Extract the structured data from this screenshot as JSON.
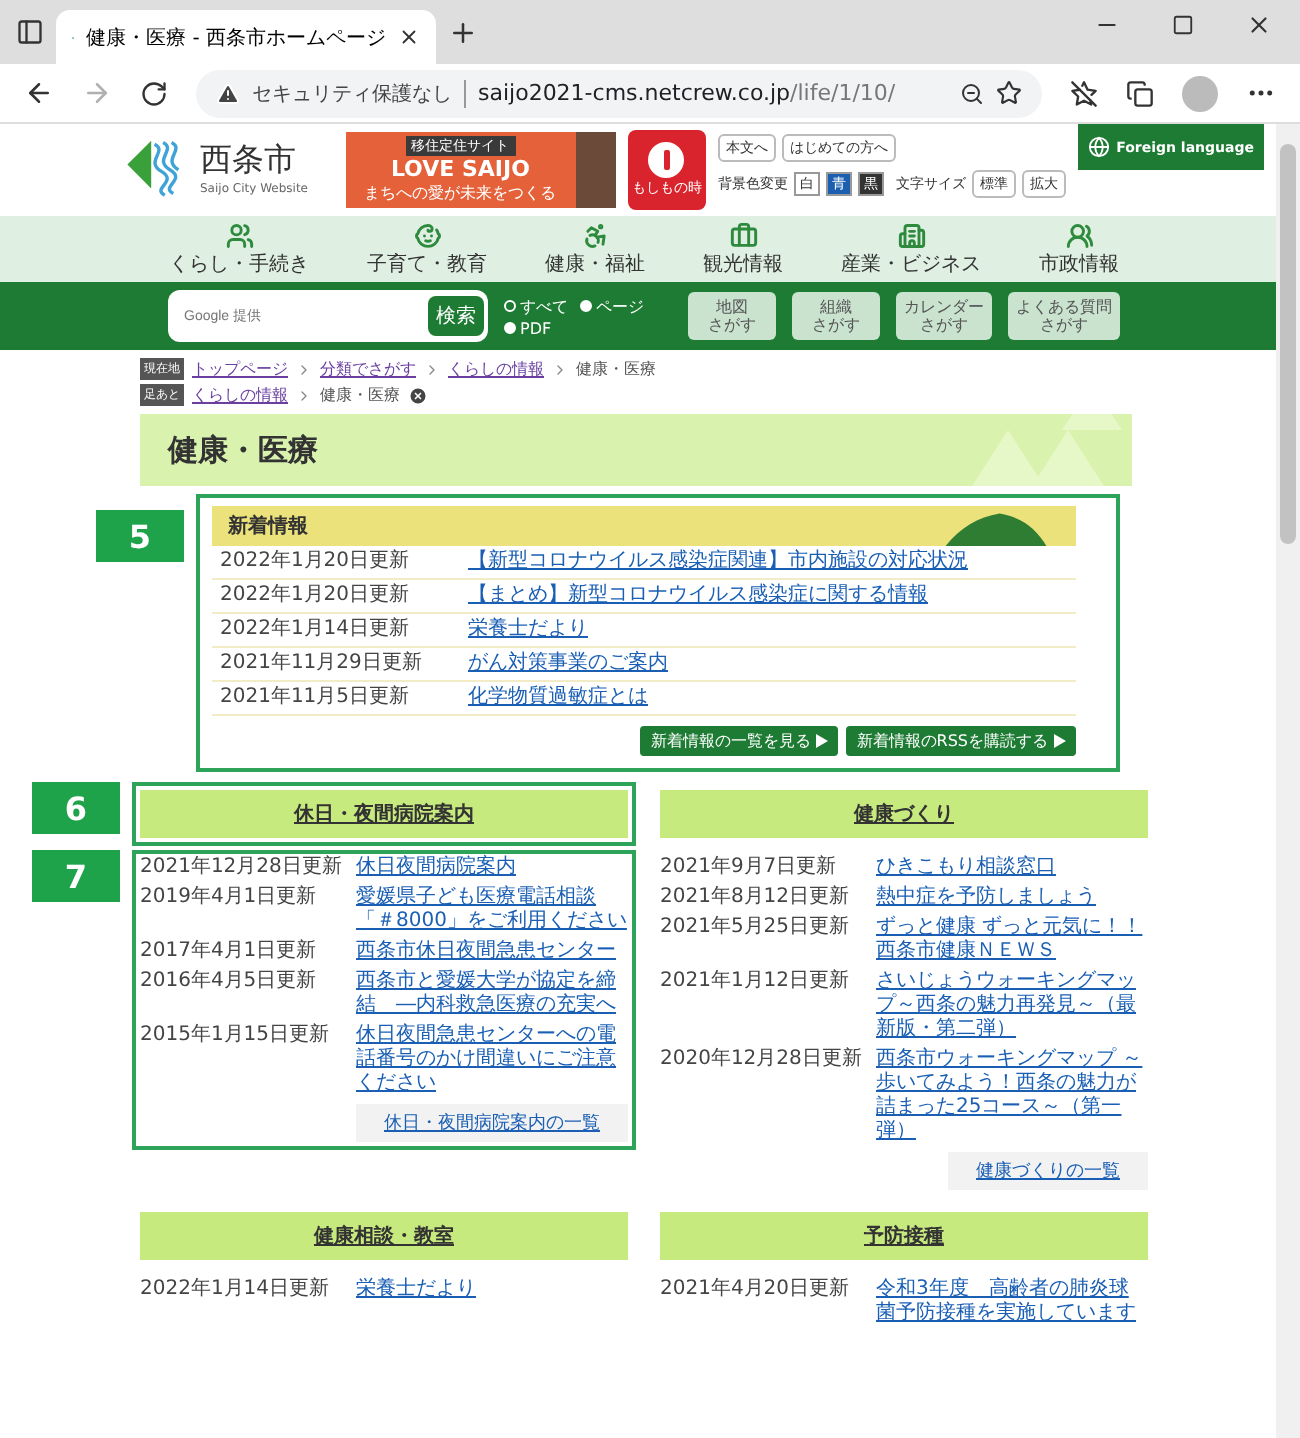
{
  "browser": {
    "tab_title": "健康・医療 - 西条市ホームページ",
    "security": "セキュリティ保護なし",
    "url_host": "saijo2021-cms.netcrew.co.jp",
    "url_path": "/life/1/10/"
  },
  "header": {
    "logo_name": "西条市",
    "logo_sub": "Saijo City Website",
    "banner_top": "移住定住サイト",
    "banner_main": "LOVE SAIJO",
    "banner_sub": "まちへの愛が未来をつくる",
    "emergency": "もしもの時",
    "links": [
      "本文へ",
      "はじめての方へ"
    ],
    "foreign": "Foreign language",
    "bg_label": "背景色変更",
    "bg_options": [
      {
        "label": "白",
        "color": "#ffffff"
      },
      {
        "label": "青",
        "color": "#1c5fb0"
      },
      {
        "label": "黒",
        "color": "#333333"
      }
    ],
    "size_label": "文字サイズ",
    "size_options": [
      "標準",
      "拡大"
    ]
  },
  "nav": [
    "くらし・手続き",
    "子育て・教育",
    "健康・福祉",
    "観光情報",
    "産業・ビジネス",
    "市政情報"
  ],
  "search": {
    "placeholder": "Google 提供",
    "button": "検索",
    "scopes": [
      {
        "label": "すべて",
        "selected": true
      },
      {
        "label": "ページ",
        "selected": false
      },
      {
        "label": "PDF",
        "selected": false
      }
    ],
    "finders": [
      {
        "lines": [
          "地図",
          "さがす"
        ]
      },
      {
        "lines": [
          "組織",
          "さがす"
        ]
      },
      {
        "lines": [
          "カレンダー",
          "さがす"
        ]
      },
      {
        "lines": [
          "よくある質問",
          "さがす"
        ]
      }
    ]
  },
  "breadcrumbs": [
    {
      "label": "現在地",
      "items": [
        {
          "text": "トップページ",
          "link": true
        },
        {
          "text": "分類でさがす",
          "link": true
        },
        {
          "text": "くらしの情報",
          "link": true
        },
        {
          "text": "健康・医療",
          "link": false
        }
      ],
      "closable": false
    },
    {
      "label": "足あと",
      "items": [
        {
          "text": "くらしの情報",
          "link": true
        },
        {
          "text": "健康・医療",
          "link": false
        }
      ],
      "closable": true
    }
  ],
  "title": "健康・医療",
  "news": {
    "marker": "5",
    "title": "新着情報",
    "rows": [
      {
        "date": "2022年1月20日更新",
        "title": "【新型コロナウイルス感染症関連】市内施設の対応状況"
      },
      {
        "date": "2022年1月20日更新",
        "title": "【まとめ】新型コロナウイルス感染症に関する情報"
      },
      {
        "date": "2022年1月14日更新",
        "title": "栄養士だより"
      },
      {
        "date": "2021年11月29日更新",
        "title": "がん対策事業のご案内"
      },
      {
        "date": "2021年11月5日更新",
        "title": "化学物質過敏症とは"
      }
    ],
    "buttons": [
      "新着情報の一覧を見る",
      "新着情報のRSSを購読する"
    ]
  },
  "sections": [
    {
      "title": "休日・夜間病院案内",
      "marker": "6",
      "list_marker": "7",
      "rows": [
        {
          "date": "2021年12月28日更新",
          "title": "休日夜間病院案内"
        },
        {
          "date": "2019年4月1日更新",
          "title": "愛媛県子ども医療電話相談「＃8000」をご利用ください"
        },
        {
          "date": "2017年4月1日更新",
          "title": "西条市休日夜間急患センター"
        },
        {
          "date": "2016年4月5日更新",
          "title": "西条市と愛媛大学が協定を締結　―内科救急医療の充実へ"
        },
        {
          "date": "2015年1月15日更新",
          "title": "休日夜間急患センターへの電話番号のかけ間違いにご注意ください"
        }
      ],
      "more": "休日・夜間病院案内の一覧"
    },
    {
      "title": "健康づくり",
      "rows": [
        {
          "date": "2021年9月7日更新",
          "title": "ひきこもり相談窓口"
        },
        {
          "date": "2021年8月12日更新",
          "title": "熱中症を予防しましょう"
        },
        {
          "date": "2021年5月25日更新",
          "title": "ずっと健康 ずっと元気に！！西条市健康ＮＥＷＳ"
        },
        {
          "date": "2021年1月12日更新",
          "title": "さいじょうウォーキングマップ～西条の魅力再発見～（最新版・第二弾）"
        },
        {
          "date": "2020年12月28日更新",
          "title": "西条市ウォーキングマップ ～歩いてみよう！西条の魅力が詰まった25コース～（第一弾）"
        }
      ],
      "more": "健康づくりの一覧"
    },
    {
      "title": "健康相談・教室",
      "rows": [
        {
          "date": "2022年1月14日更新",
          "title": "栄養士だより"
        }
      ]
    },
    {
      "title": "予防接種",
      "rows": [
        {
          "date": "2021年4月20日更新",
          "title": "令和3年度　高齢者の肺炎球菌予防接種を実施しています"
        }
      ]
    }
  ]
}
